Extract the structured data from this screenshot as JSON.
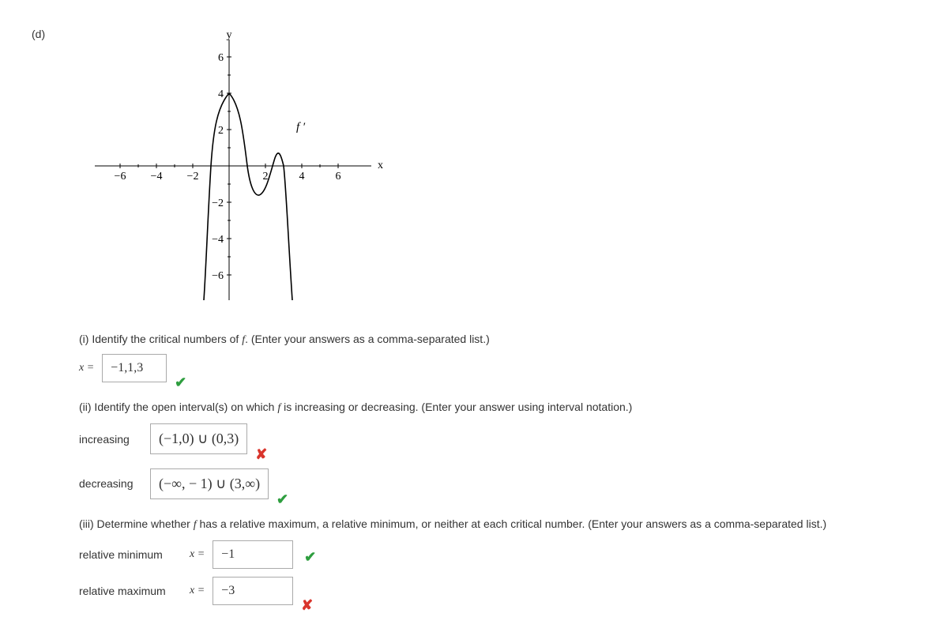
{
  "part_label": "(d)",
  "graph": {
    "y_ticks": [
      "6",
      "4",
      "2",
      "−2",
      "−4",
      "−6"
    ],
    "x_ticks": [
      "−6",
      "−4",
      "−2",
      "2",
      "4",
      "6"
    ],
    "x_label": "x",
    "y_label": "y",
    "curve_label": "f ′"
  },
  "q1": {
    "prompt_prefix": "(i) Identify the critical numbers of ",
    "prompt_f": "f",
    "prompt_suffix": ". (Enter your answers as a comma-separated list.)",
    "equals_label": "x =",
    "value": "−1,1,3",
    "correct": true
  },
  "q2": {
    "prompt_prefix": "(ii) Identify the open interval(s) on which ",
    "prompt_f": "f",
    "prompt_suffix": " is increasing or decreasing. (Enter your answer using interval notation.)",
    "increasing_label": "increasing",
    "increasing_value": "(−1,0) ∪ (0,3)",
    "increasing_correct": false,
    "decreasing_label": "decreasing",
    "decreasing_value": "(−∞, − 1) ∪ (3,∞)",
    "decreasing_correct": true
  },
  "q3": {
    "prompt_prefix": "(iii) Determine whether ",
    "prompt_f": "f",
    "prompt_suffix": " has a relative maximum, a relative minimum, or neither at each critical number. (Enter your answers as a comma-separated list.)",
    "min_label": "relative minimum",
    "equals_label": "x =",
    "min_value": "−1",
    "min_correct": true,
    "max_label": "relative maximum",
    "max_value": "−3",
    "max_correct": false
  },
  "chart_data": {
    "type": "line",
    "title": "",
    "xlabel": "x",
    "ylabel": "y",
    "series_name": "f′",
    "x_range": [
      -7,
      7
    ],
    "y_range": [
      -7,
      7
    ],
    "x_ticks": [
      -6,
      -4,
      -2,
      2,
      4,
      6
    ],
    "y_ticks": [
      -6,
      -4,
      -2,
      2,
      4,
      6
    ],
    "zeros": [
      -1,
      1,
      3
    ],
    "approx_points": [
      {
        "x": -1.5,
        "y": -7
      },
      {
        "x": -1,
        "y": 0
      },
      {
        "x": -0.5,
        "y": 3.5
      },
      {
        "x": 0,
        "y": 4
      },
      {
        "x": 0.5,
        "y": 3
      },
      {
        "x": 1,
        "y": 0
      },
      {
        "x": 1.5,
        "y": -1.6
      },
      {
        "x": 2,
        "y": -1.3
      },
      {
        "x": 2.5,
        "y": 0.5
      },
      {
        "x": 3,
        "y": 0
      },
      {
        "x": 3.5,
        "y": -7
      }
    ],
    "note": "W-shaped derivative curve; positive between x=-1 and x=1, and again between x≈2 and x=3; negative elsewhere in the visible domain"
  }
}
